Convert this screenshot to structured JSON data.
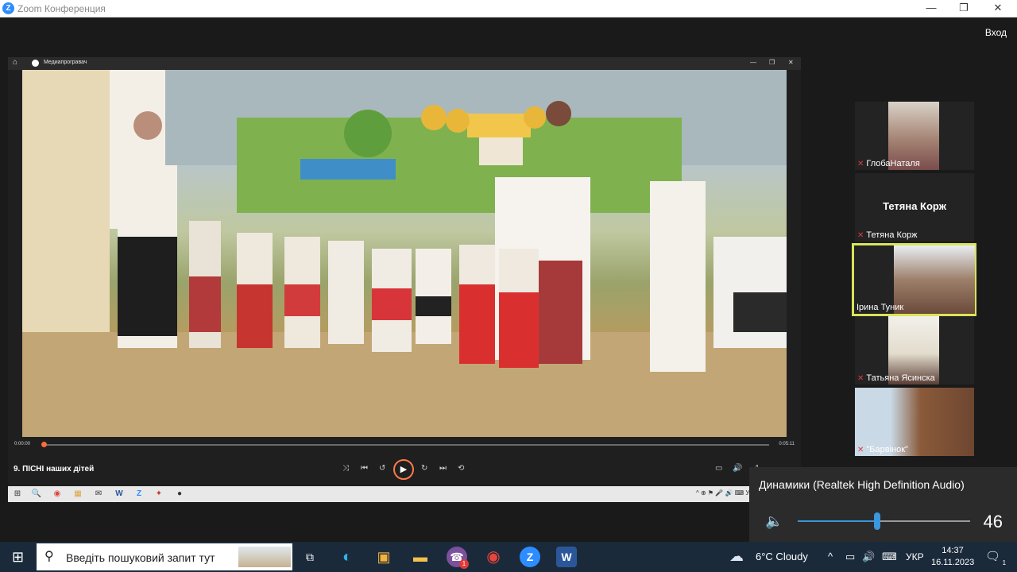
{
  "window": {
    "title": "Zoom Конференция",
    "login_label": "Вход",
    "minimize": "—",
    "restore": "❐",
    "close": "✕"
  },
  "media_player": {
    "title": "Медиапрогравач",
    "home_icon": "⌂",
    "win_controls": [
      "—",
      "❐",
      "✕"
    ],
    "time_current": "0:00:00",
    "time_total": "0:05:11",
    "progress": 0.003,
    "track_title": "9.  ПІСНІ наших дітей",
    "control_icons": [
      "⤨",
      "⏮",
      "↺",
      "▶",
      "↻",
      "⏭",
      "⟲"
    ],
    "right_icons": [
      "▭",
      "🔊",
      "⤢",
      "⋯"
    ]
  },
  "inner_taskbar": {
    "icons": [
      "⊞",
      "🔍",
      "◉",
      "▦",
      "✉",
      "W",
      "Z",
      "✦",
      "●"
    ],
    "tray": "^ ⊕ ⚑ 🎤 🔊 ⌨ УКР"
  },
  "participants": [
    {
      "name": "ГлобаНаталя",
      "muted": true,
      "has_video": true,
      "active": false
    },
    {
      "name": "Тетяна Корж",
      "muted": true,
      "has_video": false,
      "active": false
    },
    {
      "name": "Ірина Туник",
      "muted": false,
      "has_video": true,
      "active": true
    },
    {
      "name": "Татьяна Ясинска",
      "muted": true,
      "has_video": true,
      "active": false
    },
    {
      "name": "\"Барвінок\"",
      "muted": true,
      "has_video": true,
      "active": false
    }
  ],
  "volume": {
    "device": "Динамики (Realtek High Definition Audio)",
    "level": 46,
    "level_label": "46",
    "speaker_icon": "🔈"
  },
  "taskbar": {
    "start_icon": "⊞",
    "search_icon": "⚲",
    "search_placeholder": "Введіть пошуковий запит тут",
    "apps": [
      {
        "name": "task-view",
        "glyph": "⧉"
      },
      {
        "name": "edge",
        "glyph": "◐",
        "color": "#2fb4e8"
      },
      {
        "name": "store",
        "glyph": "▣",
        "color": "#f4b33c"
      },
      {
        "name": "explorer",
        "glyph": "▬",
        "color": "#f2c14e"
      },
      {
        "name": "viber",
        "glyph": "☎",
        "color": "#7b519d",
        "badge": "1"
      },
      {
        "name": "chrome",
        "glyph": "◉",
        "color": "#e8453c"
      },
      {
        "name": "zoom",
        "glyph": "Z",
        "color": "#2d8cff"
      },
      {
        "name": "word",
        "glyph": "W",
        "color": "#2b579a"
      }
    ],
    "weather_icon": "☁",
    "weather": "6°C  Cloudy",
    "tray_icons": [
      "^",
      "▭",
      "🔊",
      "⌨"
    ],
    "language": "УКР",
    "time": "14:37",
    "date": "16.11.2023",
    "notifications_icon": "🗨",
    "notifications_count": "1"
  },
  "colors": {
    "accent": "#2d8cff",
    "active_speaker": "#d9e35c",
    "mute": "#e0393e",
    "volume": "#3a96dd"
  }
}
